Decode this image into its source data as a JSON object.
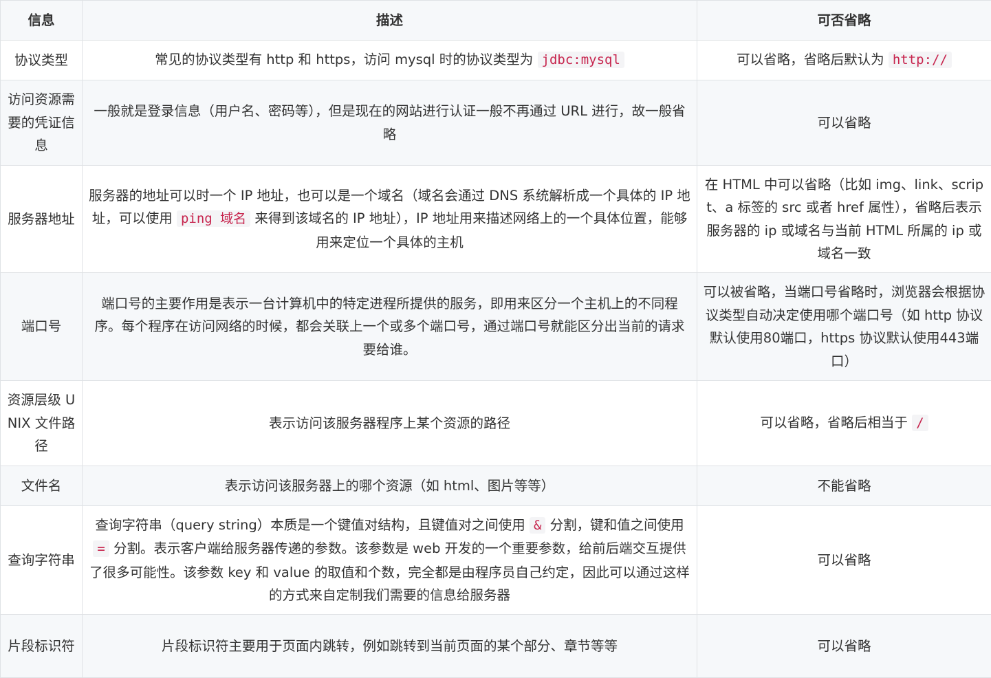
{
  "headers": [
    "信息",
    "描述",
    "可否省略"
  ],
  "rows": [
    {
      "info": "协议类型",
      "desc_parts": [
        "常见的协议类型有 http 和 https，访问 mysql 时的协议类型为 "
      ],
      "desc_code": "jdbc:mysql",
      "omit_text": "可以省略，省略后默认为 ",
      "omit_code": "http://"
    },
    {
      "info": "访问资源需要的凭证信息",
      "desc": "一般就是登录信息（用户名、密码等），但是现在的网站进行认证一般不再通过 URL 进行，故一般省略",
      "omit": "可以省略"
    },
    {
      "info": "服务器地址",
      "desc_a": "服务器的地址可以时一个 IP 地址，也可以是一个域名（域名会通过 DNS 系统解析成一个具体的 IP 地址，可以使用 ",
      "desc_code": "ping 域名",
      "desc_b": " 来得到该域名的 IP 地址），IP 地址用来描述网络上的一个具体位置，能够用来定位一个具体的主机",
      "omit": "在 HTML 中可以省略（比如 img、link、script、a 标签的 src 或者 href 属性），省略后表示服务器的 ip 或域名与当前 HTML 所属的 ip 或域名一致"
    },
    {
      "info": "端口号",
      "desc": "端口号的主要作用是表示一台计算机中的特定进程所提供的服务，即用来区分一个主机上的不同程序。每个程序在访问网络的时候，都会关联上一个或多个端口号，通过端口号就能区分出当前的请求要给谁。",
      "omit": "可以被省略，当端口号省略时，浏览器会根据协议类型自动决定使用哪个端口号（如 http 协议默认使用80端口，https 协议默认使用443端口）"
    },
    {
      "info": "资源层级 UNIX 文件路径",
      "desc": "表示访问该服务器程序上某个资源的路径",
      "omit_text": "可以省略，省略后相当于 ",
      "omit_code": "/"
    },
    {
      "info": "文件名",
      "desc": "表示访问该服务器上的哪个资源（如 html、图片等等）",
      "omit": "不能省略"
    },
    {
      "info": "查询字符串",
      "desc_a": "查询字符串（query string）本质是一个键值对结构，且键值对之间使用 ",
      "desc_code1": "&",
      "desc_b": " 分割，键和值之间使用 ",
      "desc_code2": "=",
      "desc_c": " 分割。表示客户端给服务器传递的参数。该参数是 web 开发的一个重要参数，给前后端交互提供了很多可能性。该参数 key 和 value 的取值和个数，完全都是由程序员自己约定，因此可以通过这样的方式来自定制我们需要的信息给服务器",
      "omit": "可以省略"
    },
    {
      "info": "片段标识符",
      "desc": "片段标识符主要用于页面内跳转，例如跳转到当前页面的某个部分、章节等等",
      "omit": "可以省略"
    }
  ]
}
